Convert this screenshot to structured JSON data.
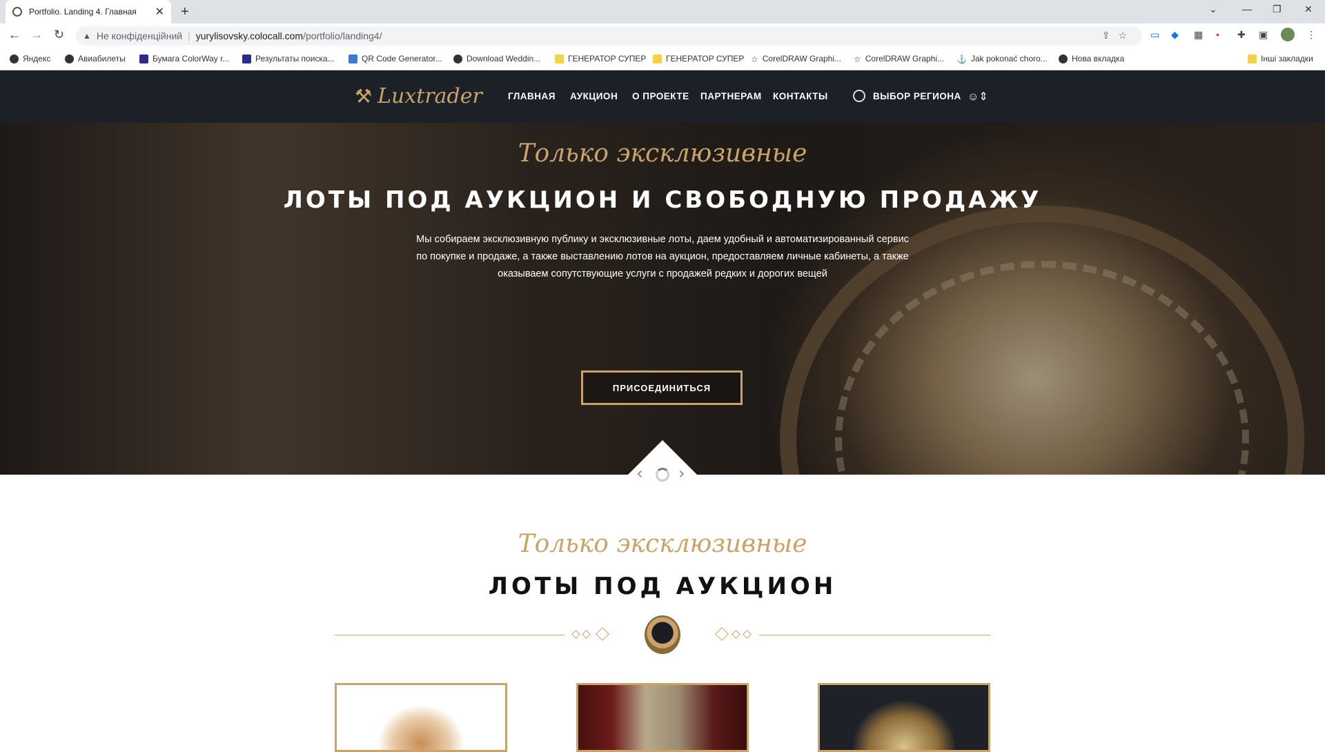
{
  "browser": {
    "tab_title": "Portfolio. Landing 4. Главная",
    "address": {
      "security_label": "Не конфіденційний",
      "host": "yurylisovsky.colocall.com",
      "path": "/portfolio/landing4/"
    },
    "bookmarks": [
      {
        "label": "Яндекс",
        "icon": "globe-icon"
      },
      {
        "label": "Авиабилеты",
        "icon": "globe-icon"
      },
      {
        "label": "Бумага ColorWay r...",
        "icon": "c-icon"
      },
      {
        "label": "Результаты поиска...",
        "icon": "c-icon"
      },
      {
        "label": "QR Code Generator...",
        "icon": "qr-icon"
      },
      {
        "label": "Download Weddin...",
        "icon": "star-badge-icon"
      },
      {
        "label": "ГЕНЕРАТОР СУПЕР",
        "icon": "folder-icon"
      },
      {
        "label": "ГЕНЕРАТОР СУПЕР",
        "icon": "folder-icon"
      },
      {
        "label": "CorelDRAW Graphi...",
        "icon": "star-icon"
      },
      {
        "label": "CorelDRAW Graphi...",
        "icon": "star-icon"
      },
      {
        "label": "Jak pokonać choro...",
        "icon": "anchor-icon"
      },
      {
        "label": "Нова вкладка",
        "icon": "globe-icon"
      }
    ],
    "other_bookmarks": "Інші закладки"
  },
  "site": {
    "logo_text": "Luxtrader",
    "nav": [
      "ГЛАВНАЯ",
      "АУКЦИОН",
      "О ПРОЕКТЕ",
      "ПАРТНЕРАМ",
      "КОНТАКТЫ"
    ],
    "region": "ВЫБОР РЕГИОНА"
  },
  "hero": {
    "script": "Только эксклюзивные",
    "title": "ЛОТЫ ПОД АУКЦИОН И СВОБОДНУЮ ПРОДАЖУ",
    "description": "Мы собираем эксклюзивную публику и эксклюзивные лоты, даем удобный и автоматизированный сервис по покупке и продаже, а также выставлению лотов на аукцион, предоставляем личные кабинеты, а также оказываем сопутствующие услуги с продажей редких и дорогих вещей",
    "button": "ПРИСОЕДИНИТЬСЯ"
  },
  "section": {
    "script": "Только эксклюзивные",
    "title": "ЛОТЫ ПОД АУКЦИОН"
  },
  "colors": {
    "gold": "#c9a36a",
    "header_bg": "#1c2027"
  }
}
